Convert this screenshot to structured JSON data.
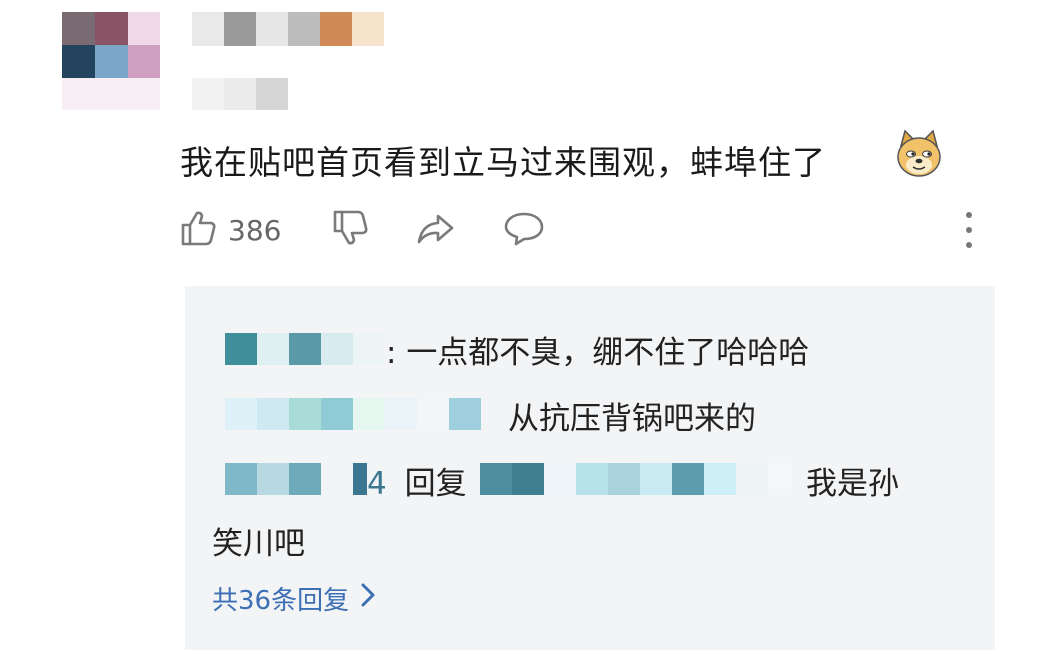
{
  "comment": {
    "text": "我在贴吧首页看到立马过来围观，蚌埠住了",
    "emoji_icon": "doge-emoji",
    "like_count": "386"
  },
  "icons": {
    "like": "thumbs-up-icon",
    "dislike": "thumbs-down-icon",
    "share": "share-icon",
    "reply": "comment-bubble-icon",
    "more": "more-vertical-icon",
    "expand": "chevron-right-icon"
  },
  "replies": [
    {
      "separator": ":",
      "text": "一点都不臭，绷不住了哈哈哈"
    },
    {
      "text": "从抗压背锅吧来的"
    },
    {
      "fragment": "4",
      "reply_word": "回复",
      "text": "我是孙",
      "text_cont": "笑川吧"
    }
  ],
  "more_replies_label": "共36条回复",
  "colors": {
    "link": "#3d6fb5",
    "panel_bg": "#f3f4f6",
    "icon_gray": "#7a7a7a"
  }
}
